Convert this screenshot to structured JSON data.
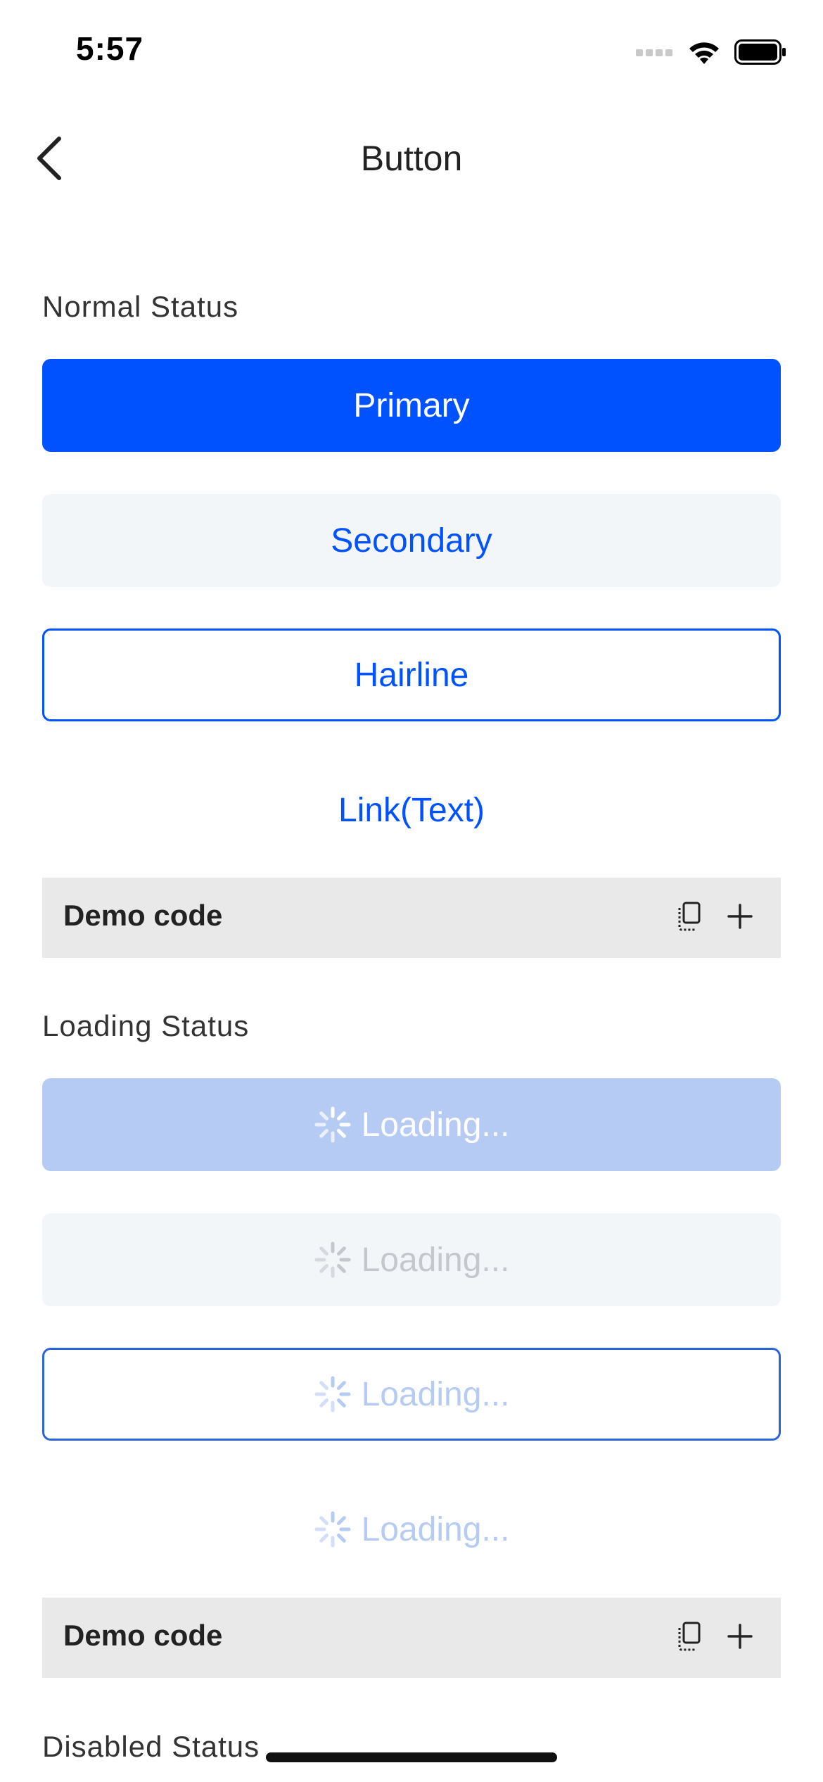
{
  "status_bar": {
    "time": "5:57"
  },
  "nav": {
    "title": "Button",
    "back_icon": "chevron-left-icon"
  },
  "sections": {
    "normal": {
      "title": "Normal Status",
      "primary_label": "Primary",
      "secondary_label": "Secondary",
      "hairline_label": "Hairline",
      "link_label": "Link(Text)"
    },
    "loading": {
      "title": "Loading Status",
      "loading_label": "Loading..."
    },
    "disabled": {
      "title": "Disabled Status"
    }
  },
  "demo": {
    "label": "Demo code",
    "copy_icon": "copy-icon",
    "expand_icon": "plus-icon"
  },
  "colors": {
    "brand_blue": "#0052ff",
    "loading_blue": "#b6cbf4",
    "secondary_bg": "#f3f6f9",
    "demo_bg": "#e9e9e9"
  }
}
